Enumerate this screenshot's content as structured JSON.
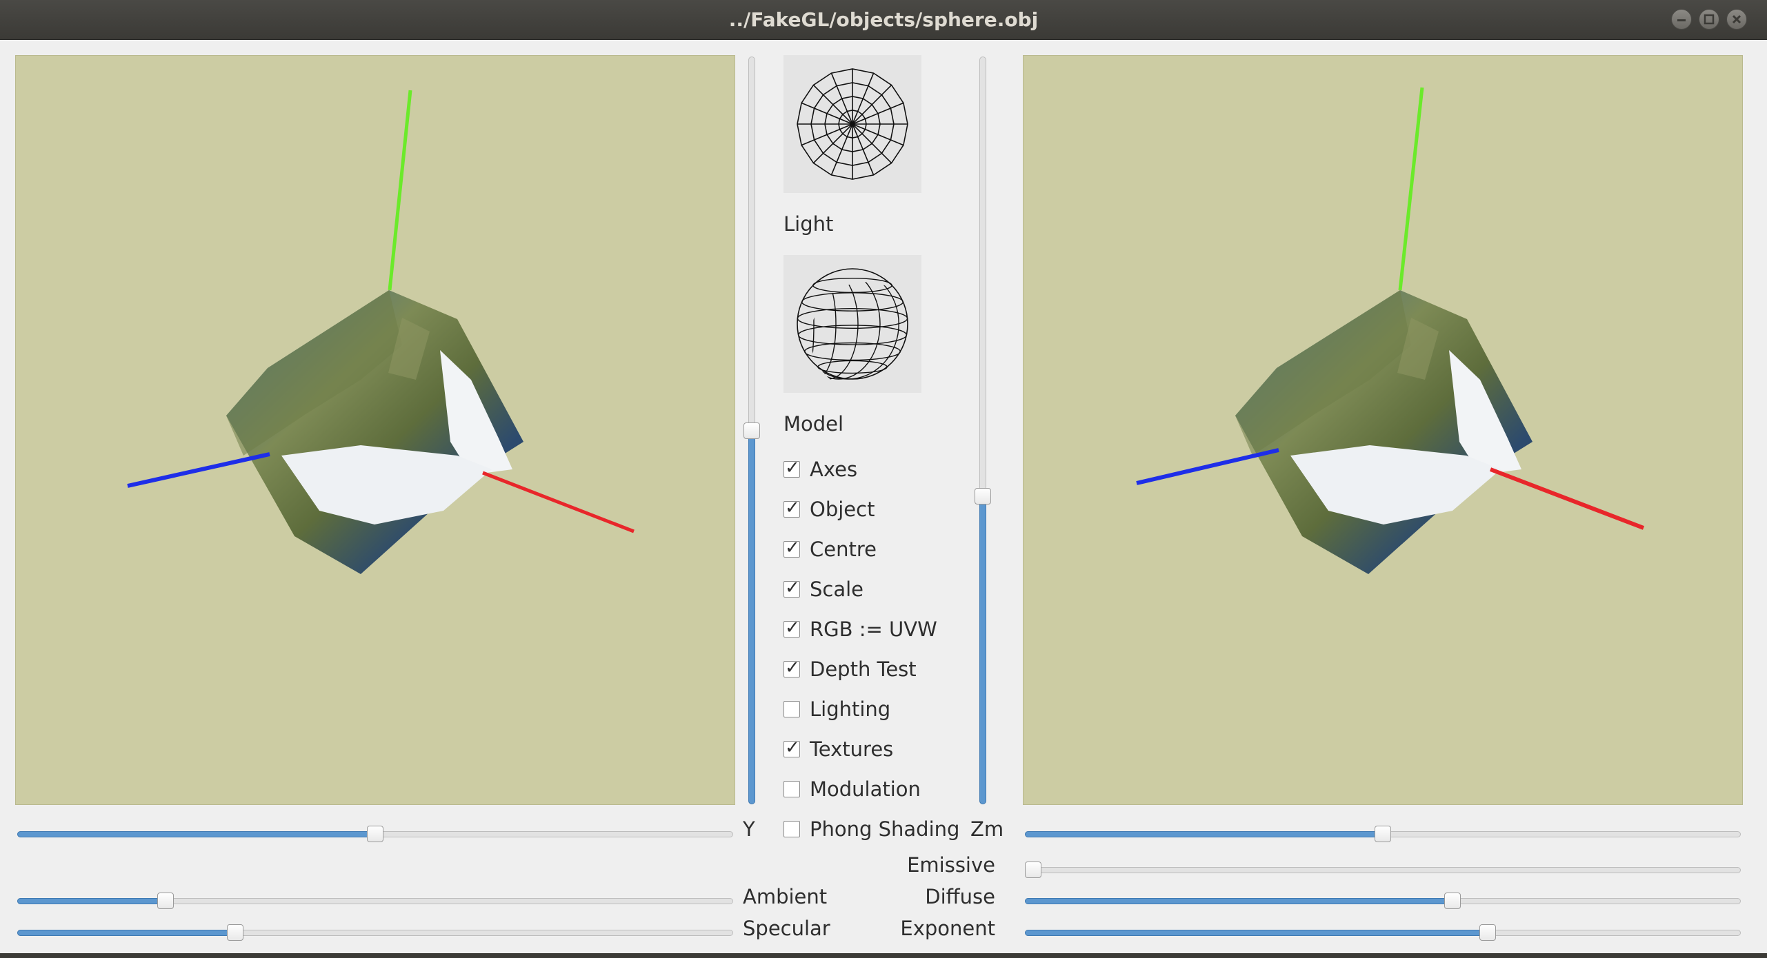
{
  "window": {
    "title": "../FakeGL/objects/sphere.obj"
  },
  "colors": {
    "viewport_bg": "#cccca3",
    "slider_fill": "#5c97cf",
    "axis_x": "#e8262a",
    "axis_y": "#6bea2a",
    "axis_z": "#1e2ee8"
  },
  "controls": {
    "light_label": "Light",
    "model_label": "Model",
    "checkboxes": [
      {
        "label": "Axes",
        "checked": true
      },
      {
        "label": "Object",
        "checked": true
      },
      {
        "label": "Centre",
        "checked": true
      },
      {
        "label": "Scale",
        "checked": true
      },
      {
        "label": "RGB := UVW",
        "checked": true
      },
      {
        "label": "Depth Test",
        "checked": true
      },
      {
        "label": "Lighting",
        "checked": false
      },
      {
        "label": "Textures",
        "checked": true
      },
      {
        "label": "Modulation",
        "checked": false
      },
      {
        "label": "Phong Shading",
        "checked": false
      }
    ]
  },
  "sliders": {
    "y": {
      "label": "Y",
      "value": 0.5
    },
    "zm": {
      "label": "Zm",
      "value": 0.5
    },
    "ambient": {
      "label": "Ambient",
      "value": 0.2
    },
    "specular": {
      "label": "Specular",
      "value": 0.3
    },
    "emissive": {
      "label": "Emissive",
      "value": 0.0
    },
    "diffuse": {
      "label": "Diffuse",
      "value": 0.6
    },
    "exponent": {
      "label": "Exponent",
      "value": 0.65
    },
    "vertical_left": {
      "value": 0.5
    },
    "vertical_right": {
      "value": 0.41
    }
  },
  "icons": {
    "light_icon": "polar-grid-icon",
    "model_icon": "wireframe-sphere-icon",
    "minimize": "minimize-icon",
    "maximize": "maximize-icon",
    "close": "close-icon"
  }
}
